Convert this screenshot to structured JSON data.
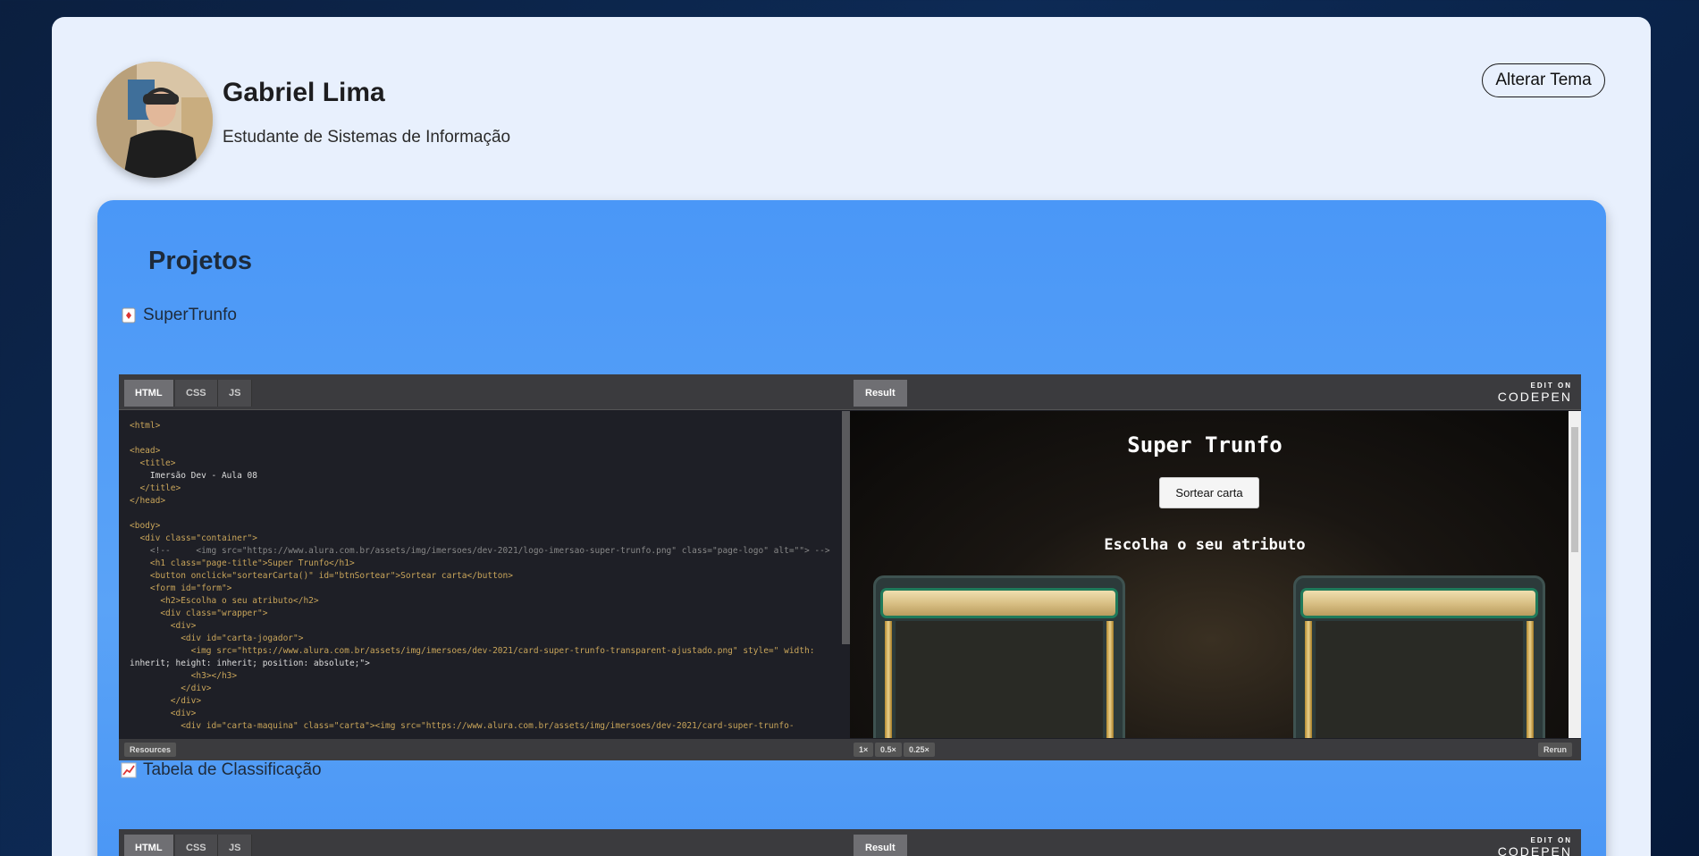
{
  "profile": {
    "name": "Gabriel Lima",
    "role": "Estudante de Sistemas de Informação",
    "theme_button": "Alterar Tema"
  },
  "projects": {
    "title": "Projetos",
    "items": [
      {
        "label": "SuperTrunfo",
        "pen": {
          "tabs": [
            "HTML",
            "CSS",
            "JS"
          ],
          "result_tab": "Result",
          "edit_on": "EDIT ON",
          "brand": "CODEPEN",
          "code": [
            "<html>",
            "",
            "<head>",
            "  <title>",
            "    Imersão Dev - Aula 08",
            "  </title>",
            "</head>",
            "",
            "<body>",
            "  <div class=\"container\">",
            "    <!--     <img src=\"https://www.alura.com.br/assets/img/imersoes/dev-2021/logo-imersao-super-trunfo.png\" class=\"page-logo\" alt=\"\"> -->",
            "    <h1 class=\"page-title\">Super Trunfo</h1>",
            "    <button onclick=\"sortearCarta()\" id=\"btnSortear\">Sortear carta</button>",
            "    <form id=\"form\">",
            "      <h2>Escolha o seu atributo</h2>",
            "      <div class=\"wrapper\">",
            "        <div>",
            "          <div id=\"carta-jogador\">",
            "            <img src=\"https://www.alura.com.br/assets/img/imersoes/dev-2021/card-super-trunfo-transparent-ajustado.png\" style=\" width:",
            "inherit; height: inherit; position: absolute;\">",
            "            <h3></h3>",
            "          </div>",
            "        </div>",
            "        <div>",
            "          <div id=\"carta-maquina\" class=\"carta\"><img src=\"https://www.alura.com.br/assets/img/imersoes/dev-2021/card-super-trunfo-"
          ],
          "result": {
            "title": "Super Trunfo",
            "button": "Sortear carta",
            "subtitle": "Escolha o seu atributo"
          },
          "footer": {
            "resources": "Resources",
            "zoom": [
              "1×",
              "0.5×",
              "0.25×"
            ],
            "rerun": "Rerun"
          }
        }
      },
      {
        "label": "Tabela de Classificação",
        "pen": {
          "tabs": [
            "HTML",
            "CSS",
            "JS"
          ],
          "result_tab": "Result",
          "edit_on": "EDIT ON",
          "brand": "CODEPEN"
        }
      }
    ]
  }
}
